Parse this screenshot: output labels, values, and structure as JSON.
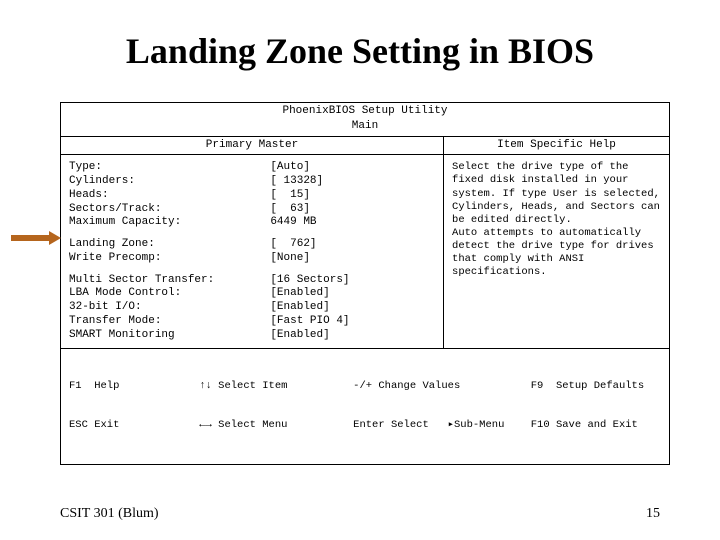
{
  "slide": {
    "title": "Landing Zone Setting in BIOS",
    "footer_left": "CSIT 301 (Blum)",
    "footer_right": "15"
  },
  "bios": {
    "utility_title": "PhoenixBIOS Setup Utility",
    "tab": "Main",
    "subheader_left": "Primary Master",
    "subheader_right": "Item Specific Help",
    "settings": {
      "g1": [
        {
          "label": "Type:",
          "value": "[Auto]"
        },
        {
          "label": "Cylinders:",
          "value": "[ 13328]"
        },
        {
          "label": "Heads:",
          "value": "[  15]"
        },
        {
          "label": "Sectors/Track:",
          "value": "[  63]"
        },
        {
          "label": "Maximum Capacity:",
          "value": "6449 MB"
        }
      ],
      "g2": [
        {
          "label": "Landing Zone:",
          "value": "[  762]"
        },
        {
          "label": "Write Precomp:",
          "value": "[None]"
        }
      ],
      "g3": [
        {
          "label": "Multi Sector Transfer:",
          "value": "[16 Sectors]"
        },
        {
          "label": "LBA Mode Control:",
          "value": "[Enabled]"
        },
        {
          "label": "32-bit I/O:",
          "value": "[Enabled]"
        },
        {
          "label": "Transfer Mode:",
          "value": "[Fast PIO 4]"
        },
        {
          "label": "SMART Monitoring",
          "value": "[Enabled]"
        }
      ]
    },
    "help_text": "Select the drive type of the fixed disk installed in your system. If type User is selected, Cylinders, Heads, and Sectors can be edited directly.\nAuto attempts to automatically detect the drive type for drives that comply with ANSI specifications.",
    "footer_keys": {
      "c1a": "F1  Help",
      "c1b": "ESC Exit",
      "c2a": "↑↓ Select Item",
      "c2b": "←→ Select Menu",
      "c3a": "-/+ Change Values",
      "c3b": "Enter Select   ▸Sub-Menu",
      "c4a": "F9  Setup Defaults",
      "c4b": "F10 Save and Exit"
    }
  }
}
